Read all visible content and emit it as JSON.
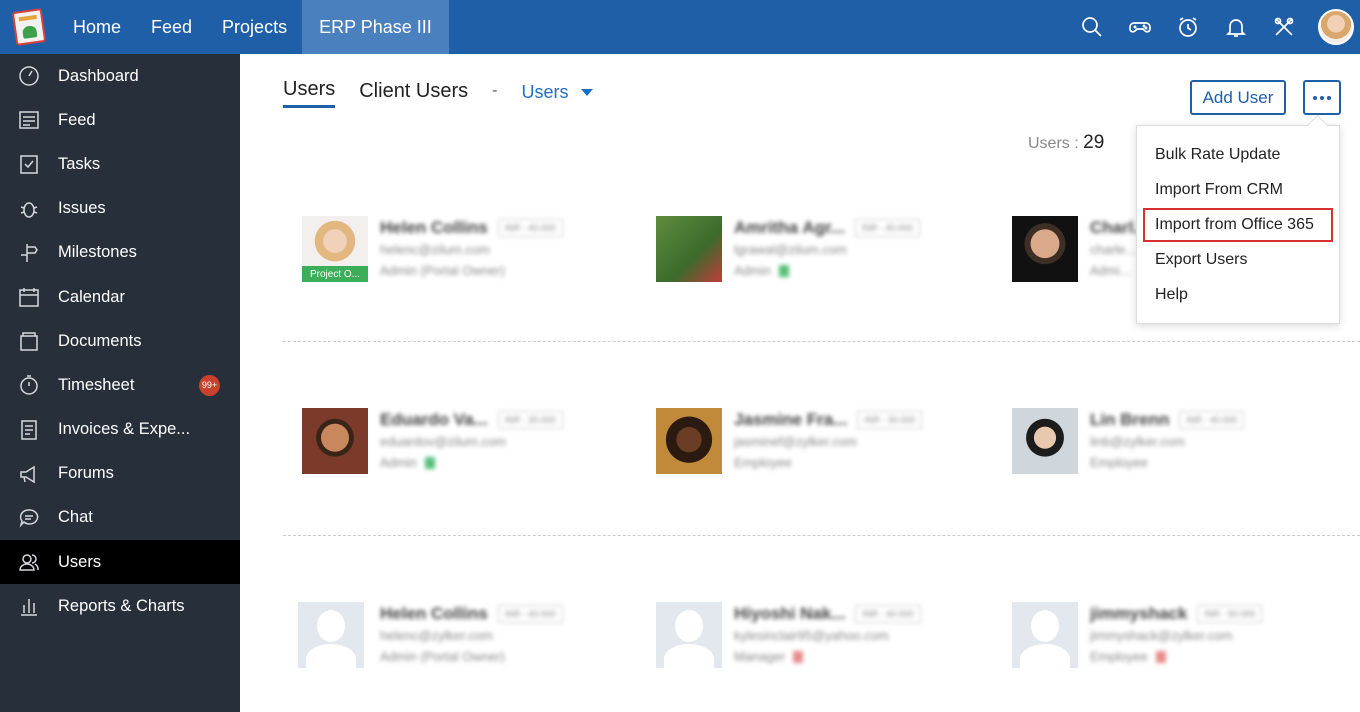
{
  "topbar": {
    "nav": [
      "Home",
      "Feed",
      "Projects",
      "ERP Phase III"
    ],
    "active_nav": "ERP Phase III",
    "icons": [
      "search-icon",
      "gamepad-icon",
      "timer-icon",
      "bell-icon",
      "tools-icon",
      "user-avatar"
    ]
  },
  "sidebar": {
    "items": [
      {
        "label": "Dashboard",
        "icon": "dashboard-icon"
      },
      {
        "label": "Feed",
        "icon": "feed-icon"
      },
      {
        "label": "Tasks",
        "icon": "tasks-icon"
      },
      {
        "label": "Issues",
        "icon": "bug-icon"
      },
      {
        "label": "Milestones",
        "icon": "signpost-icon"
      },
      {
        "label": "Calendar",
        "icon": "calendar-icon"
      },
      {
        "label": "Documents",
        "icon": "documents-icon"
      },
      {
        "label": "Timesheet",
        "icon": "stopwatch-icon",
        "badge": "99+"
      },
      {
        "label": "Invoices & Expe...",
        "icon": "invoice-icon"
      },
      {
        "label": "Forums",
        "icon": "megaphone-icon"
      },
      {
        "label": "Chat",
        "icon": "chat-icon"
      },
      {
        "label": "Users",
        "icon": "users-icon",
        "active": true
      },
      {
        "label": "Reports & Charts",
        "icon": "reports-icon"
      }
    ]
  },
  "main": {
    "tabs": [
      "Users",
      "Client Users"
    ],
    "separator": "-",
    "filter": "Users",
    "add_user": "Add User",
    "users_count_label": "Users :",
    "users_count": "29",
    "menu": [
      "Bulk Rate Update",
      "Import From CRM",
      "Import from Office 365",
      "Export Users",
      "Help"
    ],
    "menu_highlight": "Import from Office 365",
    "users": [
      {
        "name": "Helen Collins",
        "rate": "INR - 40.000",
        "email": "helenc@zilum.com",
        "role": "Admin (Portal Owner)",
        "tag": "Project O..."
      },
      {
        "name": "Amritha Agr...",
        "rate": "INR - 40.000",
        "email": "lgrawal@zilum.com",
        "role": "Admin"
      },
      {
        "name": "Charl...",
        "rate": "",
        "email": "charle...",
        "role": "Admi..."
      },
      {
        "name": "Eduardo Va...",
        "rate": "INR - 30.000",
        "email": "eduardov@zilum.com",
        "role": "Admin"
      },
      {
        "name": "Jasmine Fra...",
        "rate": "INR - 30.000",
        "email": "jasminef@zylker.com",
        "role": "Employee"
      },
      {
        "name": "Lin Brenn",
        "rate": "INR - 40.000",
        "email": "linb@zylker.com",
        "role": "Employee"
      },
      {
        "name": "Helen Collins",
        "rate": "INR - 40.000",
        "email": "helenc@zylker.com",
        "role": "Admin (Portal Owner)"
      },
      {
        "name": "Hiyoshi Nak...",
        "rate": "INR - 40.000",
        "email": "kylesinclair95@yahoo.com",
        "role": "Manager"
      },
      {
        "name": "jimmyshack",
        "rate": "INR - 50.000",
        "email": "jimmyshack@zylker.com",
        "role": "Employee"
      }
    ]
  }
}
